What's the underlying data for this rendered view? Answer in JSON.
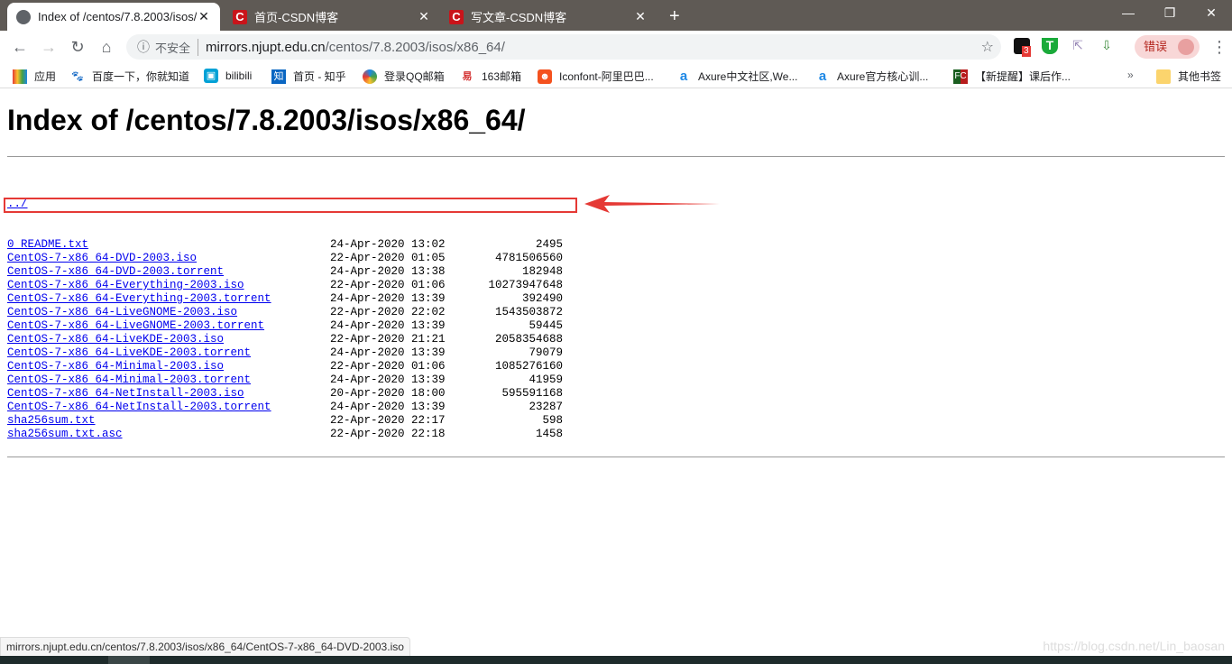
{
  "browser": {
    "tabs": [
      {
        "title": "Index of /centos/7.8.2003/isos/x86_64/",
        "icon": "globe-icon",
        "active": true
      },
      {
        "title": "首页-CSDN博客",
        "icon": "csdn-icon"
      },
      {
        "title": "写文章-CSDN博客",
        "icon": "csdn-icon"
      }
    ],
    "new_tab": "+",
    "address": {
      "security_label": "不安全",
      "host": "mirrors.njupt.edu.cn",
      "path": "/centos/7.8.2003/isos/x86_64/"
    },
    "extension_badge": "3",
    "profile_label": "错误",
    "bookmarks": [
      "应用",
      "百度一下，你就知道",
      "bilibili",
      "首页 - 知乎",
      "登录QQ邮箱",
      "163邮箱",
      "Iconfont-阿里巴巴...",
      "Axure中文社区,We...",
      "Axure官方核心训...",
      "【新提醒】课后作..."
    ],
    "bookmarks_overflow": "»",
    "other_bookmarks": "其他书签",
    "status_url": "mirrors.njupt.edu.cn/centos/7.8.2003/isos/x86_64/CentOS-7-x86_64-DVD-2003.iso",
    "watermark": "https://blog.csdn.net/Lin_baosan"
  },
  "page": {
    "title": "Index of /centos/7.8.2003/isos/x86_64/",
    "parent_link": "../",
    "files": [
      {
        "name": "0_README.txt",
        "date": "24-Apr-2020 13:02",
        "size": "2495"
      },
      {
        "name": "CentOS-7-x86_64-DVD-2003.iso",
        "date": "22-Apr-2020 01:05",
        "size": "4781506560",
        "highlighted": true
      },
      {
        "name": "CentOS-7-x86_64-DVD-2003.torrent",
        "date": "24-Apr-2020 13:38",
        "size": "182948"
      },
      {
        "name": "CentOS-7-x86_64-Everything-2003.iso",
        "date": "22-Apr-2020 01:06",
        "size": "10273947648"
      },
      {
        "name": "CentOS-7-x86_64-Everything-2003.torrent",
        "date": "24-Apr-2020 13:39",
        "size": "392490"
      },
      {
        "name": "CentOS-7-x86_64-LiveGNOME-2003.iso",
        "date": "22-Apr-2020 22:02",
        "size": "1543503872"
      },
      {
        "name": "CentOS-7-x86_64-LiveGNOME-2003.torrent",
        "date": "24-Apr-2020 13:39",
        "size": "59445"
      },
      {
        "name": "CentOS-7-x86_64-LiveKDE-2003.iso",
        "date": "22-Apr-2020 21:21",
        "size": "2058354688"
      },
      {
        "name": "CentOS-7-x86_64-LiveKDE-2003.torrent",
        "date": "24-Apr-2020 13:39",
        "size": "79079"
      },
      {
        "name": "CentOS-7-x86_64-Minimal-2003.iso",
        "date": "22-Apr-2020 01:06",
        "size": "1085276160"
      },
      {
        "name": "CentOS-7-x86_64-Minimal-2003.torrent",
        "date": "24-Apr-2020 13:39",
        "size": "41959"
      },
      {
        "name": "CentOS-7-x86_64-NetInstall-2003.iso",
        "date": "20-Apr-2020 18:00",
        "size": "595591168"
      },
      {
        "name": "CentOS-7-x86_64-NetInstall-2003.torrent",
        "date": "24-Apr-2020 13:39",
        "size": "23287"
      },
      {
        "name": "sha256sum.txt",
        "date": "22-Apr-2020 22:17",
        "size": "598"
      },
      {
        "name": "sha256sum.txt.asc",
        "date": "22-Apr-2020 22:18",
        "size": "1458"
      }
    ]
  },
  "colors": {
    "highlight": "#e53935",
    "link": "#0000ee",
    "tabbar": "#5f5a55"
  }
}
